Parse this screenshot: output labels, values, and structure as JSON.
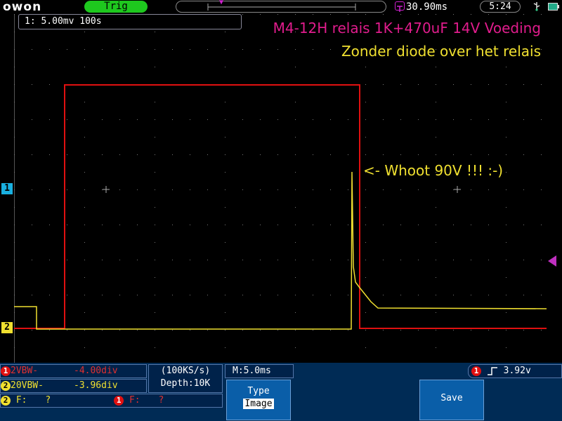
{
  "header": {
    "logo": "owon",
    "trigger_status": "Trig",
    "time_offset": "30.90ms",
    "clock": "5:24"
  },
  "measurement": {
    "ch1_readout": "1: 5.00mv 100s"
  },
  "annotations": {
    "line1": "M4-12H relais 1K+470uF 14V Voeding",
    "line2": "Zonder diode over het relais",
    "spike_note": "<- Whoot 90V !!! :-)"
  },
  "markers": {
    "ch1": "1",
    "ch2": "2"
  },
  "channels": {
    "ch1": {
      "badge": "1",
      "settings": "2VBW-",
      "offset": "-4.00div",
      "color": "#e01010"
    },
    "ch2": {
      "badge": "2",
      "settings": "20VBW-",
      "offset": "-3.96div",
      "color": "#f0e030"
    }
  },
  "frequency": {
    "ch2_badge": "2",
    "ch2_label": "F:",
    "ch2_value": "?",
    "ch1_badge": "1",
    "ch1_label": "F:",
    "ch1_value": "?"
  },
  "acquisition": {
    "sample_rate": "(100KS/s)",
    "depth": "Depth:10K",
    "timebase": "M:5.0ms"
  },
  "trigger": {
    "badge": "1",
    "level": "3.92v"
  },
  "menu": {
    "type_label": "Type",
    "type_value": "Image",
    "save_label": "Save"
  },
  "colors": {
    "grid": "#777777",
    "ch1_trace": "#e01010",
    "ch2_trace": "#f0e030",
    "accent_magenta": "#e01c8c",
    "panel_bg": "#002b55",
    "trig_green": "#1ec81e"
  }
}
